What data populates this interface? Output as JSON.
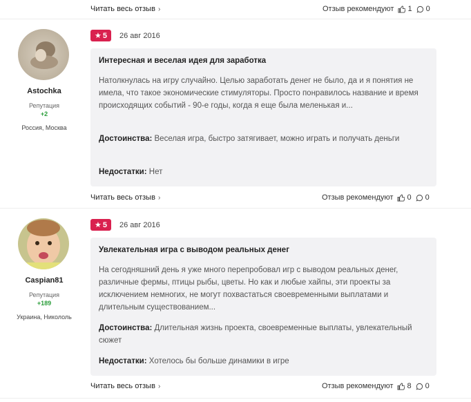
{
  "top": {
    "read_more": "Читать весь отзыв",
    "recommend": "Отзыв рекомендуют",
    "likes": "1",
    "comments": "0"
  },
  "reviews": [
    {
      "user": {
        "name": "Astochka",
        "rep_label": "Репутация",
        "rep": "+2",
        "location": "Россия, Москва"
      },
      "rating": "5",
      "date": "26 авг 2016",
      "title": "Интересная и веселая идея для заработка",
      "text": "Натолкнулась на игру случайно. Целью заработать денег не было, да и я понятия не имела, что такое экономические стимуляторы. Просто понравилось название и время происходящих событий - 90-е годы, когда я еще была меленькая и...",
      "pros_label": "Достоинства:",
      "pros": "Веселая игра, быстро затягивает, можно играть и получать деньги",
      "cons_label": "Недостатки:",
      "cons": "Нет",
      "read_more": "Читать весь отзыв",
      "recommend": "Отзыв рекомендуют",
      "likes": "0",
      "comments": "0"
    },
    {
      "user": {
        "name": "Caspian81",
        "rep_label": "Репутация",
        "rep": "+189",
        "location": "Украина, Никололь"
      },
      "rating": "5",
      "date": "26 авг 2016",
      "title": "Увлекательная игра с выводом реальных денег",
      "text": "На сегодняшний день я уже много перепробовал игр с выводом реальных денег, различные фермы, птицы рыбы, цветы. Но как и любые хайпы, эти проекты за исключением немногих, не могут похвастаться своевременными выплатами и длительным существованием...",
      "pros_label": "Достоинства:",
      "pros": "Длительная жизнь проекта, своевременные выплаты, увлекательный сюжет",
      "cons_label": "Недостатки:",
      "cons": "Хотелось бы больше динамики в игре",
      "read_more": "Читать весь отзыв",
      "recommend": "Отзыв рекомендуют",
      "likes": "8",
      "comments": "0"
    }
  ],
  "colors": {
    "badge": "#d9214f",
    "reputation": "#2a9d3a",
    "card_bg": "#f2f2f4"
  }
}
